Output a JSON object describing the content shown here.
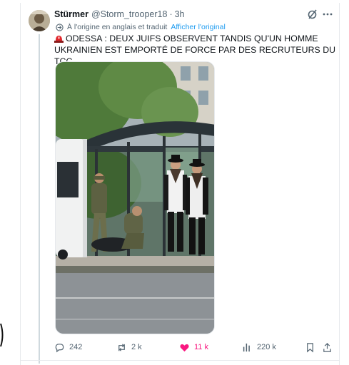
{
  "tweet": {
    "author_name": "Stürmer",
    "handle": "@Storm_trooper18",
    "separator": "·",
    "time": "3h",
    "translation_note": "À l'origine en anglais et traduit",
    "show_original_label": "Afficher l'original",
    "text": "ODESSA : DEUX JUIFS OBSERVENT TANDIS QU'UN HOMME UKRAINIEN EST EMPORTÉ DE FORCE PAR DES RECRUTEURS DU TCC",
    "lead_icon": "police-light-emoji"
  },
  "actions": {
    "reply_count": "242",
    "repost_count": "2 k",
    "like_count": "11 k",
    "views_count": "220 k"
  },
  "icons": {
    "reply": "speech-bubble-icon",
    "repost": "repost-arrows-icon",
    "like": "heart-filled-icon",
    "views": "bar-chart-icon",
    "bookmark": "bookmark-icon",
    "share": "share-upload-icon",
    "grok": "grok-slash-circle-icon",
    "more": "ellipsis-icon"
  },
  "colors": {
    "text_primary": "#0f1419",
    "text_secondary": "#536471",
    "link": "#1d9bf0",
    "like_active": "#f91880",
    "border": "#e6e9ec"
  }
}
